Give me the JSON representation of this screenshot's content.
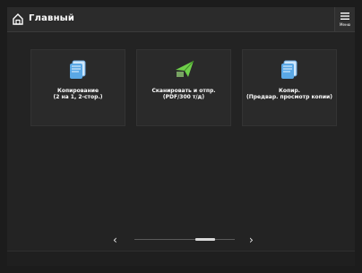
{
  "header": {
    "title": "Главный",
    "menu_label": "Меню"
  },
  "tiles": [
    {
      "title_line1": "Копирование",
      "title_line2": "(2 на 1, 2-стор.)",
      "icon": "copy-icon"
    },
    {
      "title_line1": "Сканировать и отпр.",
      "title_line2": "(PDF/300 т/д)",
      "icon": "scan-send-icon"
    },
    {
      "title_line1": "Копир.",
      "title_line2": "(Предвар. просмотр копии)",
      "icon": "copy-preview-icon"
    }
  ],
  "pager": {
    "prev": "‹",
    "next": "›",
    "position": 0.6
  },
  "colors": {
    "accent_blue": "#5aa8e6",
    "accent_green": "#6fcf4a"
  }
}
